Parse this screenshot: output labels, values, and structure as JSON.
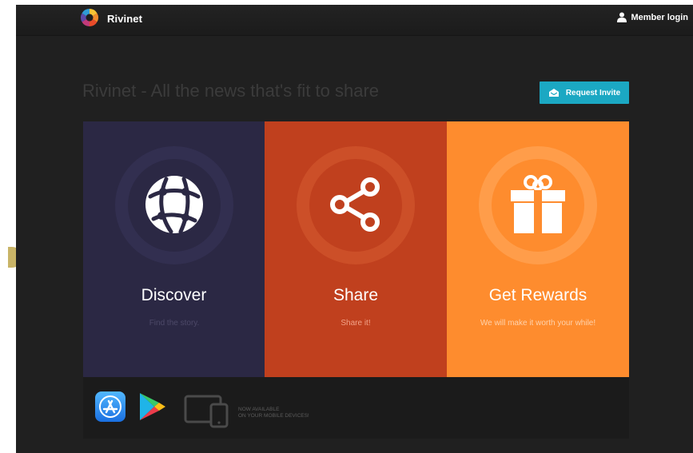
{
  "header": {
    "brand": "Rivinet",
    "member_login": "Member login"
  },
  "hero": {
    "tagline": "Rivinet - All the news that's fit to share",
    "invite_button": "Request Invite"
  },
  "tiles": [
    {
      "title": "Discover",
      "subtitle": "Find the story.",
      "icon": "globe-network-icon",
      "color": "#2b2844"
    },
    {
      "title": "Share",
      "subtitle": "Share it!",
      "icon": "share-icon",
      "color": "#c0401e"
    },
    {
      "title": "Get Rewards",
      "subtitle": "We will make it worth your while!",
      "icon": "gift-icon",
      "color": "#fe8c2e"
    }
  ],
  "footer": {
    "availability_line1": "NOW AVAILABLE",
    "availability_line2": "ON YOUR MOBILE DEVICES!",
    "icons": [
      "app-store-icon",
      "google-play-icon",
      "mobile-devices-icon"
    ]
  },
  "colors": {
    "accent": "#1ba8c3",
    "background": "#202020"
  }
}
